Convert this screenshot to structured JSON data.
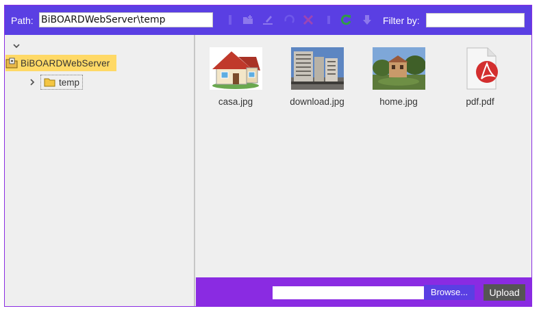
{
  "toolbar": {
    "path_label": "Path:",
    "path_value": "BiBOARDWebServer\\temp",
    "filter_label": "Filter by:",
    "filter_value": "",
    "icons": [
      "new-folder-icon",
      "rename-icon",
      "undo-icon",
      "delete-icon",
      "info-icon",
      "refresh-icon",
      "download-icon"
    ]
  },
  "tree": {
    "root_label": "BiBOARDWebServer",
    "children": [
      {
        "label": "temp"
      }
    ]
  },
  "files": [
    {
      "name": "casa.jpg",
      "icon": "house-thumbnail"
    },
    {
      "name": "download.jpg",
      "icon": "buildings-thumbnail"
    },
    {
      "name": "home.jpg",
      "icon": "villa-thumbnail"
    },
    {
      "name": "pdf.pdf",
      "icon": "pdf-file-icon"
    }
  ],
  "upload": {
    "browse_label": "Browse...",
    "upload_label": "Upload"
  },
  "colors": {
    "toolbar": "#5a3fe3",
    "bottombar": "#8a2be2",
    "tree_selected": "#ffd966",
    "refresh": "#2f9e44"
  }
}
